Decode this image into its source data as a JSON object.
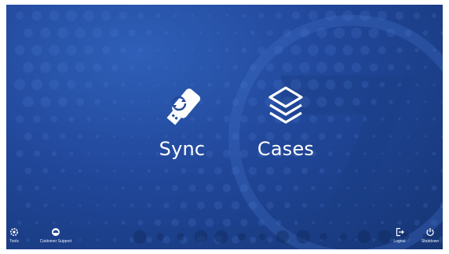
{
  "colors": {
    "background": "#21479a",
    "foreground": "#ffffff"
  },
  "tiles": [
    {
      "label": "Sync",
      "icon": "usb-sync-icon"
    },
    {
      "label": "Cases",
      "icon": "stacked-layers-icon"
    }
  ],
  "footer": {
    "tools": {
      "label": "Tools",
      "icon": "gear-icon"
    },
    "support": {
      "label": "Customer Support",
      "icon": "support-icon"
    },
    "logout": {
      "label": "Logout",
      "icon": "logout-icon"
    },
    "shutdown": {
      "label": "Shutdown",
      "icon": "power-icon"
    }
  }
}
